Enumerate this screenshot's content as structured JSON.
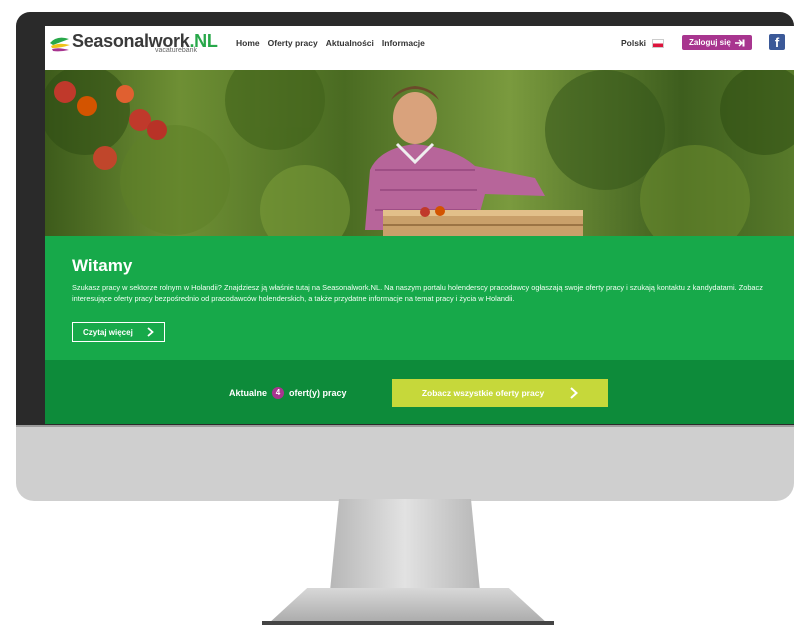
{
  "header": {
    "logo_main": "Seasonalwork",
    "logo_tld": ".NL",
    "logo_sub": "vacaturebank",
    "nav": [
      "Home",
      "Oferty pracy",
      "Aktualności",
      "Informacje"
    ],
    "language": "Polski",
    "login_label": "Zaloguj się",
    "facebook_label": "f"
  },
  "intro": {
    "title": "Witamy",
    "text": "Szukasz pracy  w sektorze rolnym w Holandii? Znajdziesz ją właśnie tutaj na Seasonalwork.NL. Na naszym portalu holenderscy pracodawcy ogłaszają swoje oferty pracy i szukają kontaktu z kandydatami. Zobacz interesujące oferty pracy bezpośrednio od pracodawców holenderskich, a także przydatne informacje na temat pracy i życia w Holandii.",
    "read_more": "Czytaj więcej"
  },
  "jobs": {
    "prefix": "Aktualne",
    "count": "4",
    "suffix": "ofert(y) pracy",
    "button": "Zobacz wszystkie oferty pracy"
  },
  "colors": {
    "green": "#17a94a",
    "dark_green": "#0d8b3a",
    "purple": "#a8358f",
    "lime": "#c6d83a"
  }
}
